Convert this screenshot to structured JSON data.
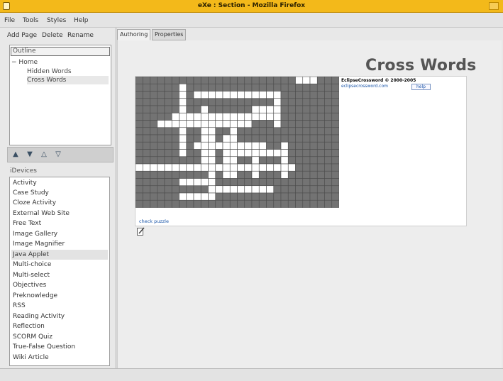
{
  "window": {
    "title": "eXe : Section - Mozilla Firefox"
  },
  "menu": [
    "File",
    "Tools",
    "Styles",
    "Help"
  ],
  "left_toolbar": {
    "add_page": "Add Page",
    "delete": "Delete",
    "rename": "Rename"
  },
  "outline": {
    "header": "Outline",
    "root": "Home",
    "root_toggle": "−",
    "children": [
      "Hidden Words",
      "Cross Words"
    ],
    "selected": "Cross Words"
  },
  "nav_icons": [
    "promote-icon",
    "demote-icon",
    "move-up-icon",
    "move-down-icon"
  ],
  "idevices": {
    "label": "iDevices",
    "items": [
      "Activity",
      "Case Study",
      "Cloze Activity",
      "External Web Site",
      "Free Text",
      "Image Gallery",
      "Image Magnifier",
      "Java Applet",
      "Multi-choice",
      "Multi-select",
      "Objectives",
      "Preknowledge",
      "RSS",
      "Reading Activity",
      "Reflection",
      "SCORM Quiz",
      "True-False Question",
      "Wiki Article"
    ],
    "selected": "Java Applet"
  },
  "tabs": [
    "Authoring",
    "Properties"
  ],
  "active_tab": "Authoring",
  "page_title": "Cross Words",
  "applet": {
    "credit": "EclipseCrossword     © 2000-2005",
    "credit_link": "eclipsecrossword.com",
    "help_label": "help",
    "check_label": "check puzzle"
  },
  "colors": {
    "title_bar": "#f3b91a",
    "grid_dark": "#737373",
    "grid_white": "#ffffff",
    "link": "#1a55a8"
  }
}
